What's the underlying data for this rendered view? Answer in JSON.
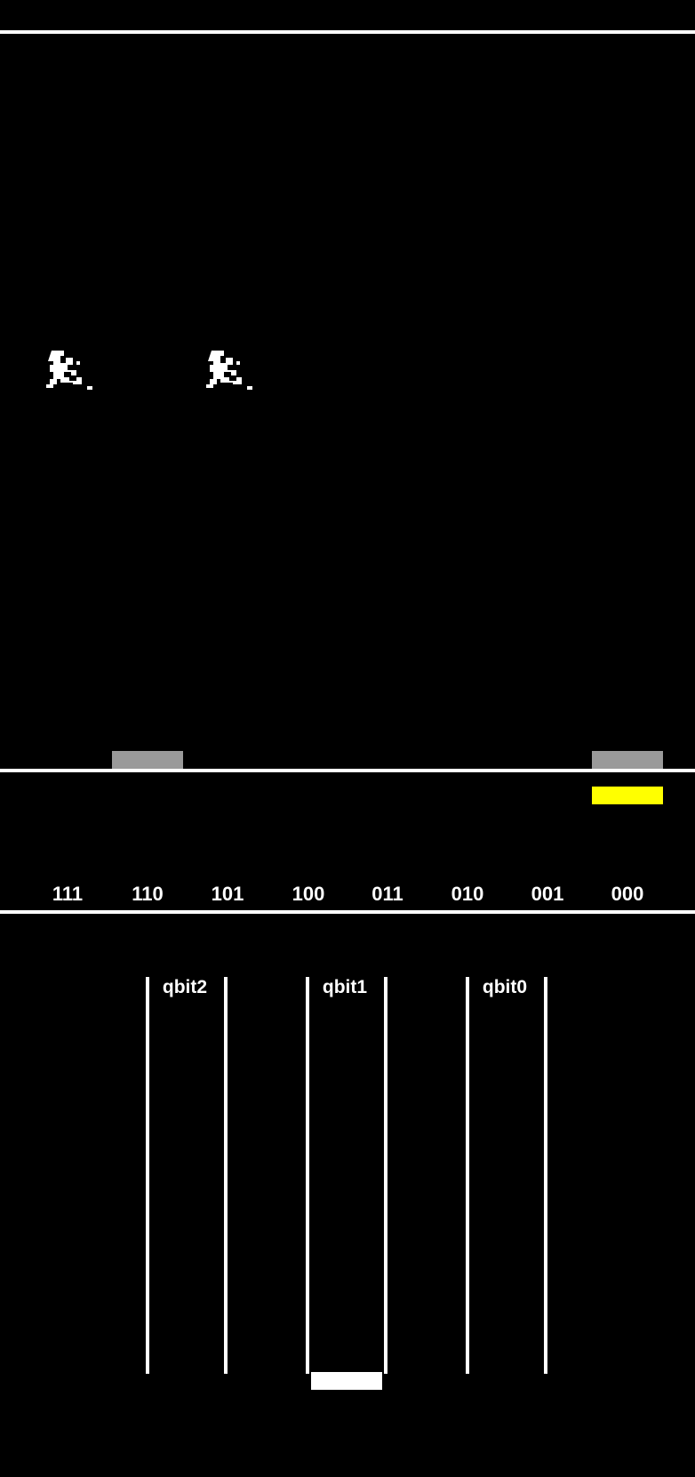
{
  "colors": {
    "background": "#000000",
    "line": "#ffffff",
    "target_block": "#9a9a9a",
    "measured_state": "#ffff00",
    "qbit_toggle": "#ffffff"
  },
  "play_area": {
    "enemies": [
      {
        "name": "enemy-1",
        "icon": "invader-sprite"
      },
      {
        "name": "enemy-2",
        "icon": "invader-sprite"
      }
    ],
    "target_blocks": [
      {
        "state": "110"
      },
      {
        "state": "000"
      }
    ]
  },
  "state_bar": {
    "labels": [
      "111",
      "110",
      "101",
      "100",
      "011",
      "010",
      "001",
      "000"
    ],
    "measured_state": "000"
  },
  "qbits": [
    {
      "label": "qbit2",
      "toggled": false
    },
    {
      "label": "qbit1",
      "toggled": true
    },
    {
      "label": "qbit0",
      "toggled": false
    }
  ]
}
